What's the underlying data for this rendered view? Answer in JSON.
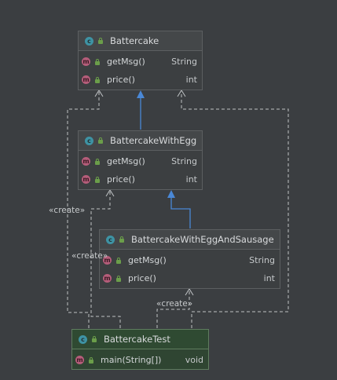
{
  "diagram": {
    "classes": [
      {
        "name": "Battercake",
        "members": [
          {
            "name": "getMsg()",
            "type": "String"
          },
          {
            "name": "price()",
            "type": "int"
          }
        ]
      },
      {
        "name": "BattercakeWithEgg",
        "members": [
          {
            "name": "getMsg()",
            "type": "String"
          },
          {
            "name": "price()",
            "type": "int"
          }
        ]
      },
      {
        "name": "BattercakeWithEggAndSausage",
        "members": [
          {
            "name": "getMsg()",
            "type": "String"
          },
          {
            "name": "price()",
            "type": "int"
          }
        ]
      },
      {
        "name": "BattercakeTest",
        "members": [
          {
            "name": "main(String[])",
            "type": "void"
          }
        ]
      }
    ],
    "create_label": "«create»",
    "class_badge": "c",
    "method_badge": "m",
    "colors": {
      "background": "#3b3e41",
      "inheritance_arrow": "#4a88d6",
      "dependency_line": "#bfc2c4",
      "selected_class": "#2f4532"
    }
  }
}
